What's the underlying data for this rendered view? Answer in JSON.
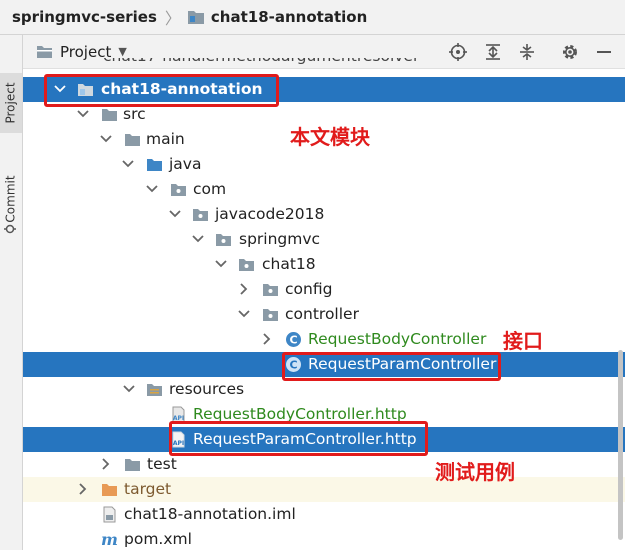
{
  "breadcrumb": {
    "root": "springmvc-series",
    "separator": "〉",
    "current": "chat18-annotation"
  },
  "side_tabs": {
    "project": "Project",
    "commit": "Commit"
  },
  "project_panel": {
    "title": "Project",
    "icons": [
      "locate-icon",
      "expand-all-icon",
      "collapse-all-icon",
      "gear-icon",
      "minimize-icon"
    ]
  },
  "tree": {
    "cut_off_row": "chat17-handlermethodargumentresolver",
    "module": "chat18-annotation",
    "src": "src",
    "main": "main",
    "java": "java",
    "com": "com",
    "javacode2018": "javacode2018",
    "springmvc": "springmvc",
    "chat18": "chat18",
    "config": "config",
    "controller": "controller",
    "request_body_controller": "RequestBodyController",
    "request_param_controller": "RequestParamController",
    "resources": "resources",
    "request_body_http": "RequestBodyController.http",
    "request_param_http": "RequestParamController.http",
    "test": "test",
    "target": "target",
    "iml": "chat18-annotation.iml",
    "pom": "pom.xml"
  },
  "annotations": {
    "module_note": "本文模块",
    "interface_note": "接口",
    "testcase_note": "测试用例"
  },
  "colors": {
    "selection": "#2675bf",
    "highlight_box": "#e11b1b",
    "folder": "#8a9aa6",
    "java_class": "#3e86c6",
    "vcs_added": "#2f8a1e",
    "excluded": "#7d5a2f"
  }
}
